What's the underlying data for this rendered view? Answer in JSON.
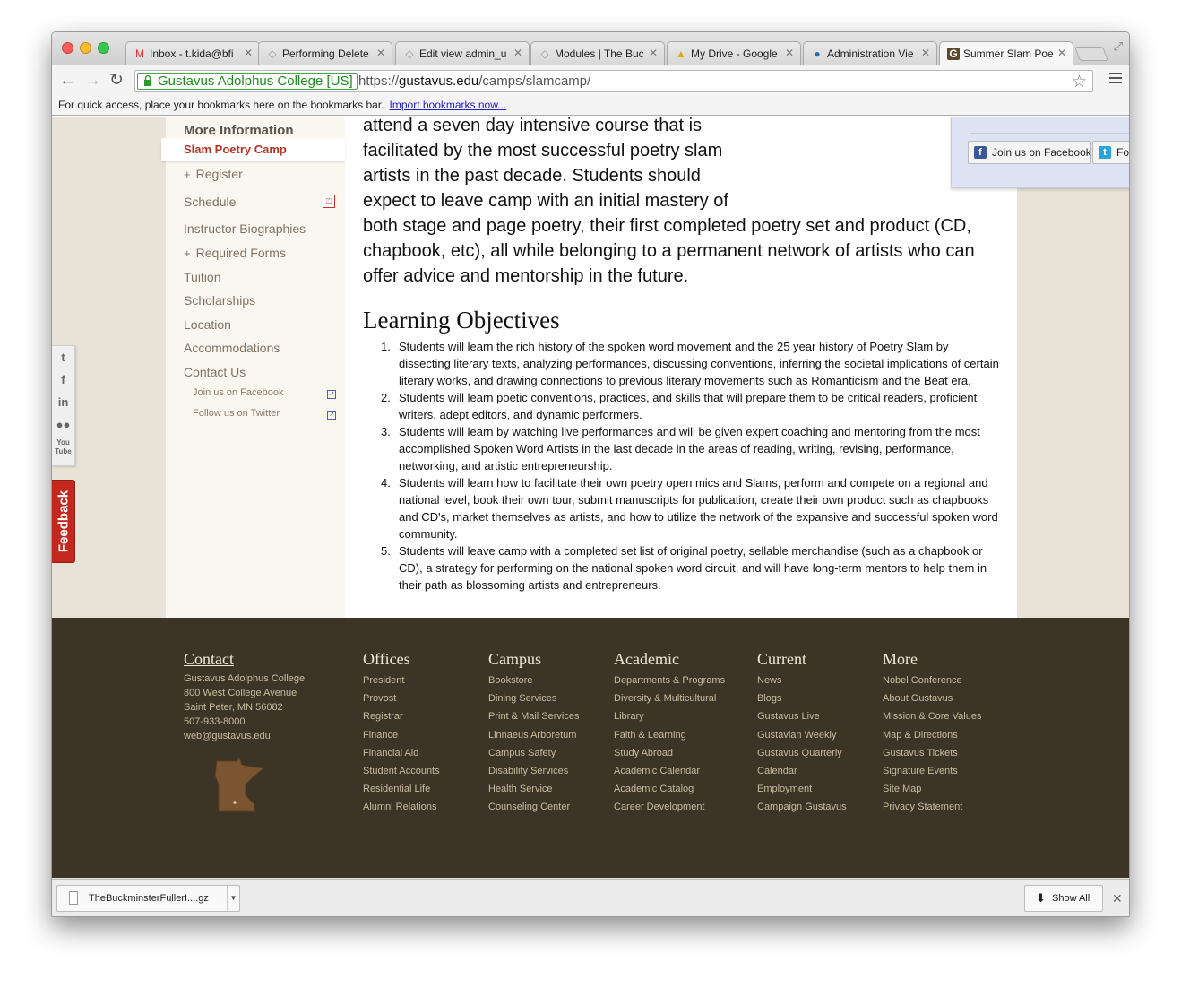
{
  "browser": {
    "tabs": [
      {
        "label": "Inbox - t.kida@bfi",
        "icon": "gmail-icon",
        "glyph": "M"
      },
      {
        "label": "Performing Delete",
        "icon": "web-icon",
        "glyph": "◇"
      },
      {
        "label": "Edit view admin_u",
        "icon": "web-icon",
        "glyph": "◇"
      },
      {
        "label": "Modules | The Buc",
        "icon": "web-icon",
        "glyph": "◇"
      },
      {
        "label": "My Drive - Google",
        "icon": "drive-icon",
        "glyph": "▲"
      },
      {
        "label": "Administration Vie",
        "icon": "drupal-icon",
        "glyph": "●"
      },
      {
        "label": "Summer Slam Poet",
        "icon": "gustavus-icon",
        "glyph": "G"
      }
    ],
    "ev_label": "Gustavus Adolphus College [US]",
    "url_scheme": "https://",
    "url_host": "gustavus.edu",
    "url_path": "/camps/slamcamp/",
    "bookmarks_text": "For quick access, place your bookmarks here on the bookmarks bar.",
    "bookmarks_link": "Import bookmarks now..."
  },
  "sidebar": {
    "heading": "More Information",
    "current": "Slam Poetry Camp",
    "register": "Register",
    "schedule": "Schedule",
    "instructor": "Instructor Biographies",
    "forms": "Required Forms",
    "tuition": "Tuition",
    "scholarships": "Scholarships",
    "location": "Location",
    "accommodations": "Accommodations",
    "contact": "Contact Us",
    "facebook": "Join us on Facebook",
    "twitter": "Follow us on Twitter"
  },
  "main": {
    "intro_lines": [
      "attend a seven day intensive course that is",
      "facilitated by the most successful poetry slam",
      "artists in the past decade. Students should",
      "expect to leave camp with an initial mastery of",
      "both stage and page poetry, their first completed poetry set and product (CD,",
      "chapbook, etc), all while belonging to a permanent network of artists who can",
      "offer advice and mentorship in the future."
    ],
    "social_facebook": "Join us on Facebook",
    "social_twitter": "Follow us on Twitter",
    "heading": "Learning Objectives",
    "objectives": [
      "Students will learn the rich history of the spoken word movement and the 25 year history of Poetry Slam by dissecting literary texts, analyzing performances, discussing conventions, inferring the societal implications of certain literary works, and drawing connections to previous literary movements such as Romanticism and the Beat era.",
      "Students will learn poetic conventions, practices, and skills that will prepare them to be critical readers, proficient writers, adept editors, and dynamic performers.",
      "Students will learn by watching live performances and will be given expert coaching and mentoring from the most accomplished Spoken Word Artists in the last decade in the areas of reading, writing, revising, performance, networking, and artistic entrepreneurship.",
      "Students will learn how to facilitate their own poetry open mics and Slams, perform and compete on a regional and national level, book their own tour, submit manuscripts for publication, create their own product such as chapbooks and CD's, market themselves as artists, and how to utilize the network of the expansive and successful spoken word community.",
      "Students will leave camp with a completed set list of original poetry, sellable merchandise (such as a chapbook or CD), a strategy for performing on the national spoken word circuit, and will have long-term mentors to help them in their path as blossoming artists and entrepreneurs."
    ]
  },
  "share": {
    "feedback": "Feedback"
  },
  "footer": {
    "contact": {
      "heading": "Contact",
      "lines": [
        "Gustavus Adolphus College",
        "800 West College Avenue",
        "Saint Peter, MN 56082",
        "507-933-8000",
        "web@gustavus.edu"
      ]
    },
    "columns": [
      {
        "heading": "Offices",
        "links": [
          "President",
          "Provost",
          "Registrar",
          "Finance",
          "Financial Aid",
          "Student Accounts",
          "Residential Life",
          "Alumni Relations"
        ]
      },
      {
        "heading": "Campus",
        "links": [
          "Bookstore",
          "Dining Services",
          "Print & Mail Services",
          "Linnaeus Arboretum",
          "Campus Safety",
          "Disability Services",
          "Health Service",
          "Counseling Center"
        ]
      },
      {
        "heading": "Academic",
        "links": [
          "Departments & Programs",
          "Diversity & Multicultural",
          "Library",
          "Faith & Learning",
          "Study Abroad",
          "Academic Calendar",
          "Academic Catalog",
          "Career Development"
        ]
      },
      {
        "heading": "Current",
        "links": [
          "News",
          "Blogs",
          "Gustavus Live",
          "Gustavian Weekly",
          "Gustavus Quarterly",
          "Calendar",
          "Employment",
          "Campaign Gustavus"
        ]
      },
      {
        "heading": "More",
        "links": [
          "Nobel Conference",
          "About Gustavus",
          "Mission & Core Values",
          "Map & Directions",
          "Gustavus Tickets",
          "Signature Events",
          "Site Map",
          "Privacy Statement"
        ]
      }
    ]
  },
  "downloads": {
    "file": "TheBuckminsterFullerI....gz",
    "show_all": "Show All"
  }
}
